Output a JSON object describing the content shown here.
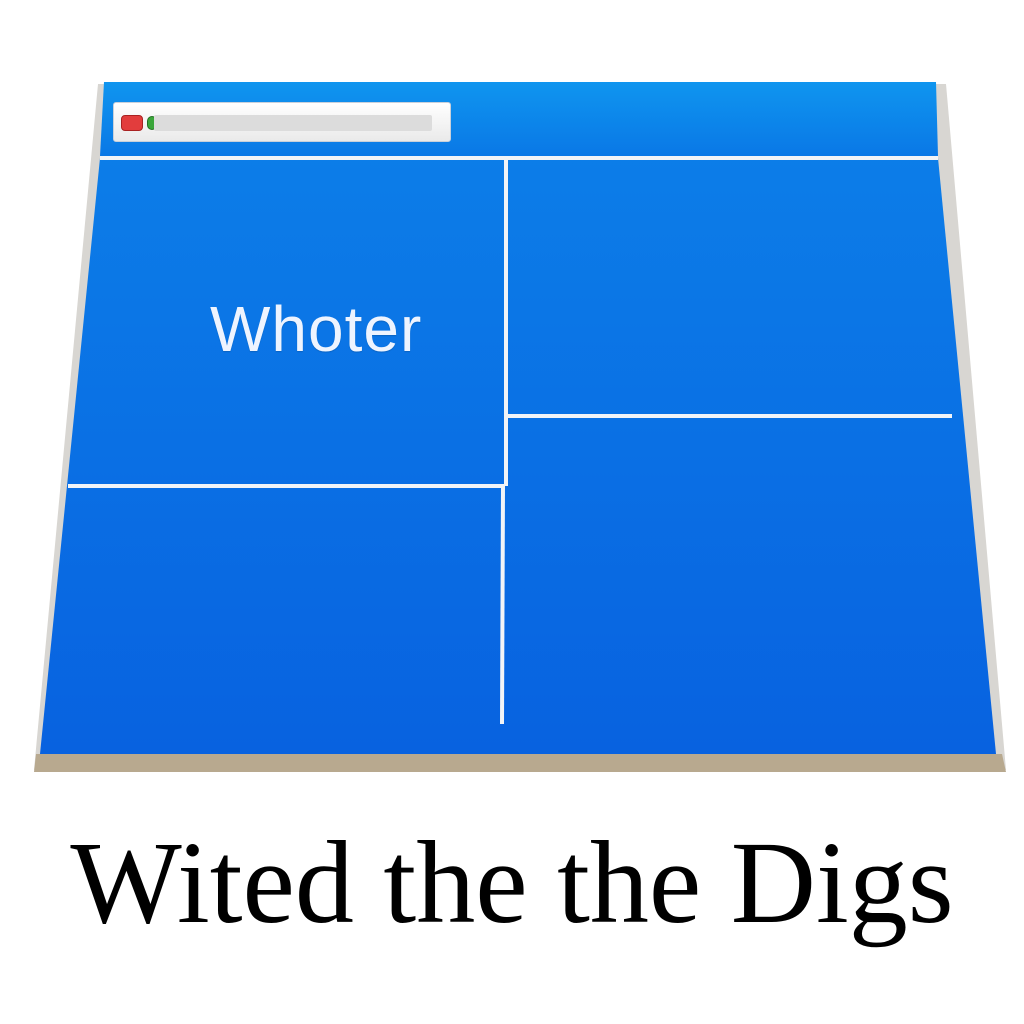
{
  "window": {
    "panel_title": "Whoter",
    "url_bar": {
      "value": ""
    },
    "colors": {
      "titlebar": "#0b8ae6",
      "panel": "#0a66e0",
      "divider": "#f2f4f7",
      "frame": "#d8d6d2"
    }
  },
  "caption": {
    "text": "Wited the the Digs"
  },
  "icons": [
    "close-button-icon",
    "zoom-button-icon"
  ]
}
